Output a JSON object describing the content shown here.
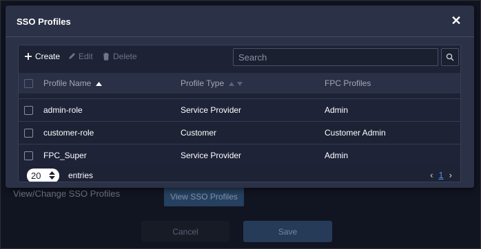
{
  "background": {
    "label": "View/Change SSO Profiles",
    "view_button": "View SSO Profiles",
    "cancel_button": "Cancel",
    "save_button": "Save"
  },
  "modal": {
    "title": "SSO Profiles",
    "close_glyph": "✕"
  },
  "toolbar": {
    "create_label": "Create",
    "edit_label": "Edit",
    "delete_label": "Delete",
    "search_placeholder": "Search",
    "search_value": ""
  },
  "table": {
    "headers": {
      "profile_name": "Profile Name",
      "profile_type": "Profile Type",
      "fpc_profiles": "FPC Profiles"
    },
    "rows": [
      {
        "profile_name": "admin-role",
        "profile_type": "Service Provider",
        "fpc_profiles": "Admin"
      },
      {
        "profile_name": "customer-role",
        "profile_type": "Customer",
        "fpc_profiles": "Customer Admin"
      },
      {
        "profile_name": "FPC_Super",
        "profile_type": "Service Provider",
        "fpc_profiles": "Admin"
      }
    ]
  },
  "footer": {
    "page_size": "20",
    "entries_label": "entries",
    "current_page": "1",
    "prev_glyph": "‹",
    "next_glyph": "›"
  },
  "colors": {
    "accent": "#4a90e2",
    "modal_bg": "#2b3146",
    "panel_bg": "#1d2235"
  },
  "icons": [
    "plus-icon",
    "pencil-icon",
    "trash-icon",
    "search-icon",
    "sort-asc-icon",
    "sort-both-icon",
    "spinner-updown-icon",
    "close-icon"
  ]
}
